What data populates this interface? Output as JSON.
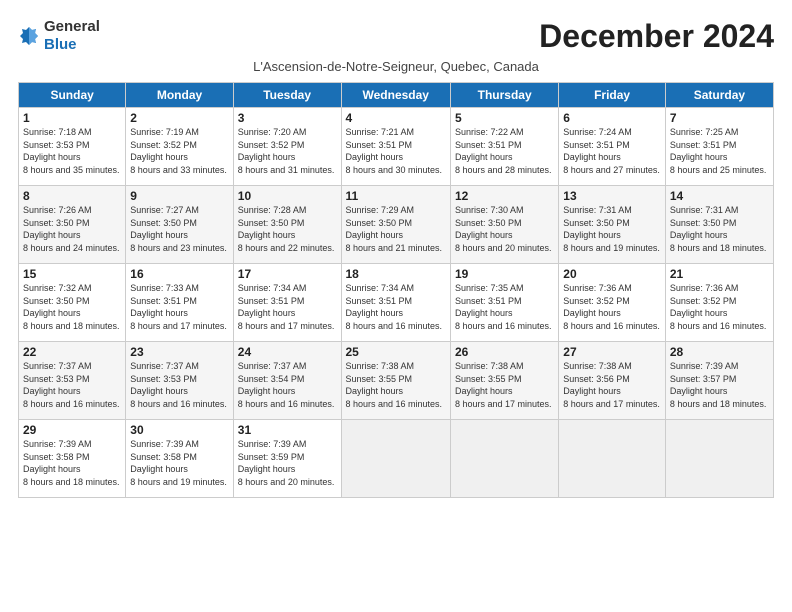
{
  "logo": {
    "general": "General",
    "blue": "Blue"
  },
  "title": "December 2024",
  "subtitle": "L'Ascension-de-Notre-Seigneur, Quebec, Canada",
  "weekdays": [
    "Sunday",
    "Monday",
    "Tuesday",
    "Wednesday",
    "Thursday",
    "Friday",
    "Saturday"
  ],
  "weeks": [
    [
      {
        "day": "1",
        "rise": "7:18 AM",
        "set": "3:53 PM",
        "hours": "8 hours and 35 minutes."
      },
      {
        "day": "2",
        "rise": "7:19 AM",
        "set": "3:52 PM",
        "hours": "8 hours and 33 minutes."
      },
      {
        "day": "3",
        "rise": "7:20 AM",
        "set": "3:52 PM",
        "hours": "8 hours and 31 minutes."
      },
      {
        "day": "4",
        "rise": "7:21 AM",
        "set": "3:51 PM",
        "hours": "8 hours and 30 minutes."
      },
      {
        "day": "5",
        "rise": "7:22 AM",
        "set": "3:51 PM",
        "hours": "8 hours and 28 minutes."
      },
      {
        "day": "6",
        "rise": "7:24 AM",
        "set": "3:51 PM",
        "hours": "8 hours and 27 minutes."
      },
      {
        "day": "7",
        "rise": "7:25 AM",
        "set": "3:51 PM",
        "hours": "8 hours and 25 minutes."
      }
    ],
    [
      {
        "day": "8",
        "rise": "7:26 AM",
        "set": "3:50 PM",
        "hours": "8 hours and 24 minutes."
      },
      {
        "day": "9",
        "rise": "7:27 AM",
        "set": "3:50 PM",
        "hours": "8 hours and 23 minutes."
      },
      {
        "day": "10",
        "rise": "7:28 AM",
        "set": "3:50 PM",
        "hours": "8 hours and 22 minutes."
      },
      {
        "day": "11",
        "rise": "7:29 AM",
        "set": "3:50 PM",
        "hours": "8 hours and 21 minutes."
      },
      {
        "day": "12",
        "rise": "7:30 AM",
        "set": "3:50 PM",
        "hours": "8 hours and 20 minutes."
      },
      {
        "day": "13",
        "rise": "7:31 AM",
        "set": "3:50 PM",
        "hours": "8 hours and 19 minutes."
      },
      {
        "day": "14",
        "rise": "7:31 AM",
        "set": "3:50 PM",
        "hours": "8 hours and 18 minutes."
      }
    ],
    [
      {
        "day": "15",
        "rise": "7:32 AM",
        "set": "3:50 PM",
        "hours": "8 hours and 18 minutes."
      },
      {
        "day": "16",
        "rise": "7:33 AM",
        "set": "3:51 PM",
        "hours": "8 hours and 17 minutes."
      },
      {
        "day": "17",
        "rise": "7:34 AM",
        "set": "3:51 PM",
        "hours": "8 hours and 17 minutes."
      },
      {
        "day": "18",
        "rise": "7:34 AM",
        "set": "3:51 PM",
        "hours": "8 hours and 16 minutes."
      },
      {
        "day": "19",
        "rise": "7:35 AM",
        "set": "3:51 PM",
        "hours": "8 hours and 16 minutes."
      },
      {
        "day": "20",
        "rise": "7:36 AM",
        "set": "3:52 PM",
        "hours": "8 hours and 16 minutes."
      },
      {
        "day": "21",
        "rise": "7:36 AM",
        "set": "3:52 PM",
        "hours": "8 hours and 16 minutes."
      }
    ],
    [
      {
        "day": "22",
        "rise": "7:37 AM",
        "set": "3:53 PM",
        "hours": "8 hours and 16 minutes."
      },
      {
        "day": "23",
        "rise": "7:37 AM",
        "set": "3:53 PM",
        "hours": "8 hours and 16 minutes."
      },
      {
        "day": "24",
        "rise": "7:37 AM",
        "set": "3:54 PM",
        "hours": "8 hours and 16 minutes."
      },
      {
        "day": "25",
        "rise": "7:38 AM",
        "set": "3:55 PM",
        "hours": "8 hours and 16 minutes."
      },
      {
        "day": "26",
        "rise": "7:38 AM",
        "set": "3:55 PM",
        "hours": "8 hours and 17 minutes."
      },
      {
        "day": "27",
        "rise": "7:38 AM",
        "set": "3:56 PM",
        "hours": "8 hours and 17 minutes."
      },
      {
        "day": "28",
        "rise": "7:39 AM",
        "set": "3:57 PM",
        "hours": "8 hours and 18 minutes."
      }
    ],
    [
      {
        "day": "29",
        "rise": "7:39 AM",
        "set": "3:58 PM",
        "hours": "8 hours and 18 minutes."
      },
      {
        "day": "30",
        "rise": "7:39 AM",
        "set": "3:58 PM",
        "hours": "8 hours and 19 minutes."
      },
      {
        "day": "31",
        "rise": "7:39 AM",
        "set": "3:59 PM",
        "hours": "8 hours and 20 minutes."
      },
      null,
      null,
      null,
      null
    ]
  ],
  "daylight_label": "Daylight hours",
  "sunrise_label": "Sunrise:",
  "sunset_label": "Sunset:"
}
